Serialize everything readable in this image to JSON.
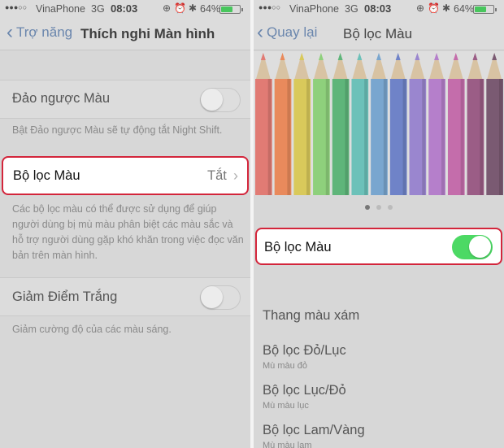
{
  "status": {
    "dots": "●●●○○",
    "carrier": "VinaPhone",
    "network": "3G",
    "time": "08:03",
    "battery_pct": "64%",
    "battery_level": 0.64
  },
  "left": {
    "nav": {
      "back_label": "Trợ năng",
      "title": "Thích nghi Màn hình"
    },
    "invert": {
      "label": "Đảo ngược Màu",
      "note": "Bật Đảo ngược Màu sẽ tự động tắt Night Shift."
    },
    "filters": {
      "label": "Bộ lọc Màu",
      "value": "Tắt"
    },
    "filters_note": "Các bộ lọc màu có thể được sử dụng để giúp người dùng bị mù màu phân biệt các màu sắc và hỗ trợ người dùng gặp khó khăn trong việc đọc văn bản trên màn hình.",
    "white_point": {
      "label": "Giảm Điểm Trắng",
      "note": "Giảm cường độ của các màu sáng."
    }
  },
  "right": {
    "nav": {
      "back_label": "Quay lại",
      "title": "Bộ lọc Màu"
    },
    "pencil_colors": [
      "#e17b74",
      "#e98a5c",
      "#d9c95b",
      "#8ed07c",
      "#5fb57a",
      "#6cc1b9",
      "#79a6cf",
      "#6f83c8",
      "#9a86cf",
      "#b57fcb",
      "#c46dab",
      "#9b5d86",
      "#7a5a72"
    ],
    "filter_toggle": {
      "label": "Bộ lọc Màu",
      "on": true
    },
    "options": [
      {
        "label": "Thang màu xám",
        "sub": ""
      },
      {
        "label": "Bộ lọc Đỏ/Lục",
        "sub": "Mù màu đỏ"
      },
      {
        "label": "Bộ lọc Lục/Đỏ",
        "sub": "Mù màu lục"
      },
      {
        "label": "Bộ lọc Lam/Vàng",
        "sub": "Mù màu lam"
      }
    ]
  },
  "colors": {
    "accent_red": "#d3253b",
    "toggle_on": "#4cd964",
    "link_blue": "#6a86ad"
  }
}
